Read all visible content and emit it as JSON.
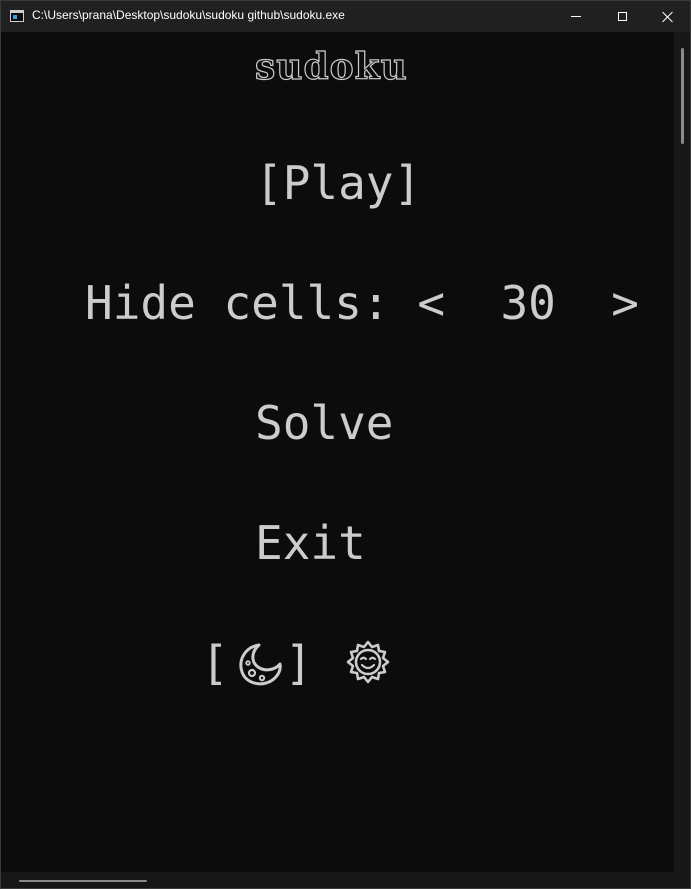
{
  "window": {
    "title": "C:\\Users\\prana\\Desktop\\sudoku\\sudoku github\\sudoku.exe"
  },
  "console": {
    "logo_text": "sudoku",
    "play_label": "[Play]",
    "hide_cells_label": "Hide cells:",
    "hide_cells_left_arrow": "<",
    "hide_cells_value": "30",
    "hide_cells_right_arrow": ">",
    "solve_label": "Solve",
    "exit_label": "Exit",
    "theme_bracket_open": "[",
    "theme_bracket_close": "]",
    "theme_dark_icon": "crescent-moon-icon",
    "theme_light_icon": "sun-face-icon"
  },
  "colors": {
    "background": "#0c0c0c",
    "text": "#cccccc",
    "titlebar": "#202020"
  }
}
